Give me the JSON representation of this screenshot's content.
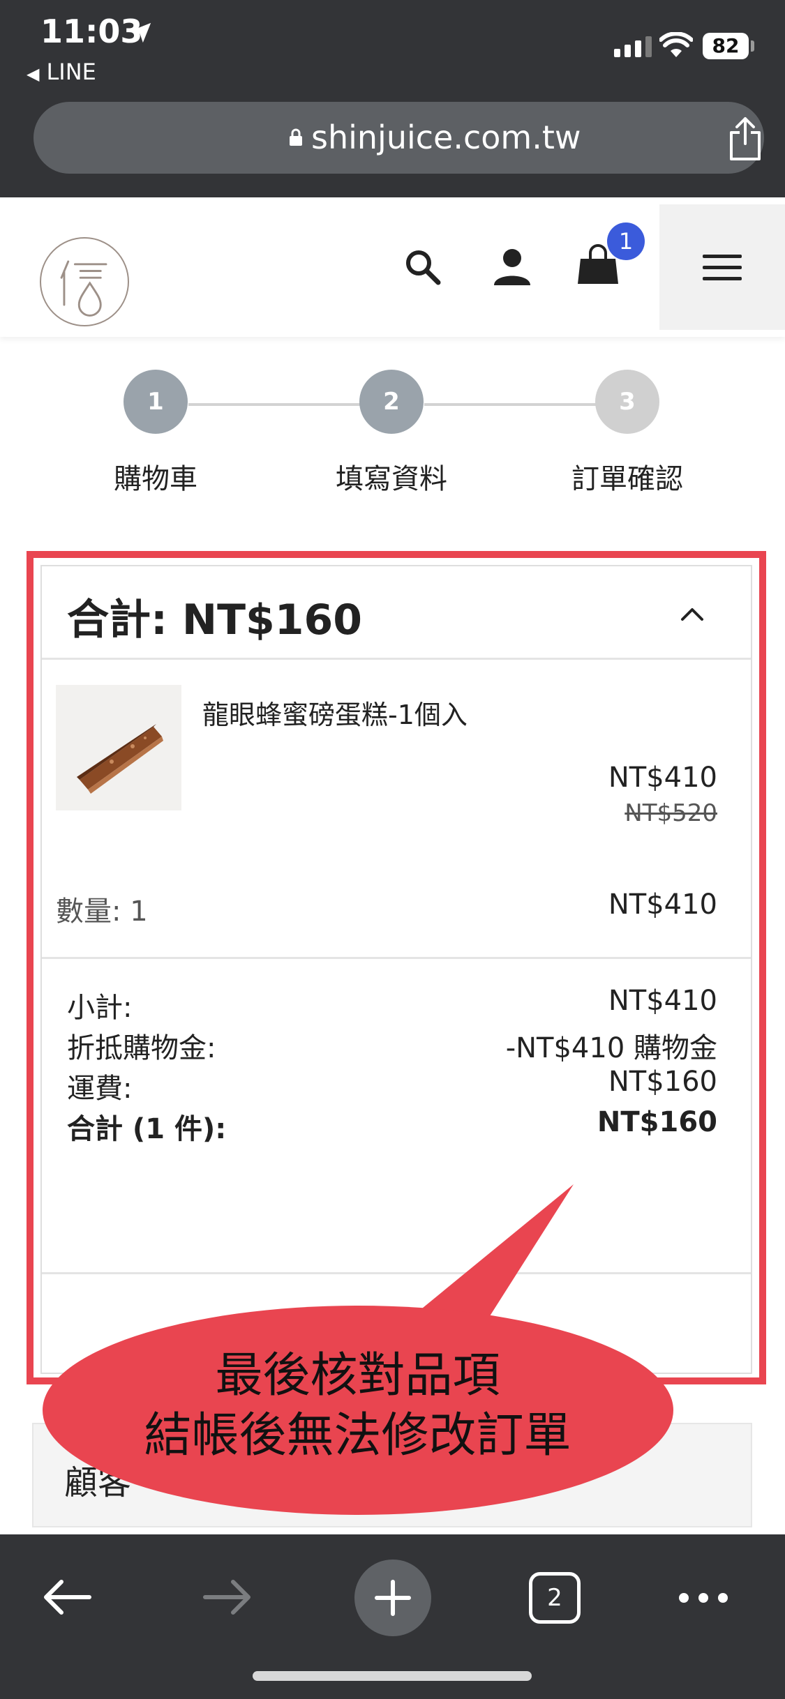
{
  "status_bar": {
    "time": "11:03",
    "back_app": "LINE",
    "battery": "82"
  },
  "browser": {
    "url": "shinjuice.com.tw",
    "open_tabs": "2"
  },
  "header": {
    "cart_count": "1"
  },
  "steps": [
    {
      "number": "1",
      "label": "購物車",
      "state": "done"
    },
    {
      "number": "2",
      "label": "填寫資料",
      "state": "current"
    },
    {
      "number": "3",
      "label": "訂單確認",
      "state": "pending"
    }
  ],
  "summary": {
    "title": "合計: NT$160",
    "item": {
      "name": "龍眼蜂蜜磅蛋糕-1個入",
      "price": "NT$410",
      "original_price": "NT$520",
      "quantity_label": "數量: 1",
      "line_total": "NT$410"
    },
    "rows": [
      {
        "label": "小計:",
        "value": "NT$410"
      },
      {
        "label": "折抵購物金:",
        "value": "-NT$410 購物金"
      },
      {
        "label": "運費:",
        "value": "NT$160"
      },
      {
        "label": "合計 (1 件):",
        "value": "NT$160"
      }
    ]
  },
  "next_section": {
    "title_visible": "顧客"
  },
  "annotation": {
    "line1": "最後核對品項",
    "line2": "結帳後無法修改訂單"
  },
  "colors": {
    "chrome": "#333437",
    "highlight": "#e94550",
    "step_active": "#9aa3ab",
    "step_pending": "#d0d0d0",
    "badge": "#3b5bdb"
  }
}
